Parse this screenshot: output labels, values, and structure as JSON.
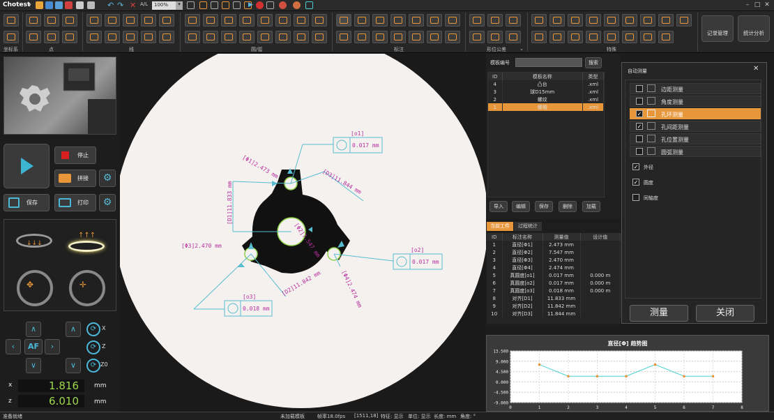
{
  "title_bar": {
    "app_name": "Chotest",
    "zoom": "100%",
    "min": "–",
    "max": "□",
    "close": "✕"
  },
  "ribbon": {
    "groups": [
      "坐标系",
      "点",
      "线",
      "圆/弧",
      "标注",
      "形位公差",
      "特殊"
    ],
    "record_button": "记录管理",
    "stats_button": "统计分析"
  },
  "left": {
    "stop_label": "停止",
    "stitch_label": "拼接",
    "save_label": "保存",
    "print_label": "打印",
    "af_label": "AF",
    "rot_x": "X",
    "rot_z": "Z",
    "rot_z0": "Z0",
    "x_label": "x",
    "x_value": "1.816",
    "x_unit": "mm",
    "z_label": "z",
    "z_value": "6.010",
    "z_unit": "mm"
  },
  "annotations": {
    "phi1": "[Φ1]2.473 mm",
    "phi2": "[Φ2]7.547 mm",
    "phi3": "[Φ3]2.470 mm",
    "phi4": "[Φ4]2.474 mm",
    "d1": "[D1]11.833 mm",
    "d2": "[D2]11.842 mm",
    "d3": "[D3]11.844 mm",
    "o1": "[o1]",
    "o1_val": "0.017 mm",
    "o2": "[o2]",
    "o2_val": "0.017 mm",
    "o3": "[o3]",
    "o3_val": "0.018 mm"
  },
  "template": {
    "label": "模板编号",
    "search": "搜索",
    "columns": [
      "ID",
      "模板名称",
      "类型"
    ],
    "rows": [
      {
        "id": "4",
        "name": "凸台",
        "type": ".xml"
      },
      {
        "id": "3",
        "name": "球D15mm",
        "type": ".xml"
      },
      {
        "id": "2",
        "name": "螺纹",
        "type": ".xml"
      },
      {
        "id": "1",
        "name": "螺帽",
        "type": ".xml"
      }
    ],
    "buttons": [
      "导入",
      "编辑",
      "保存",
      "删除",
      "加载"
    ]
  },
  "dialog": {
    "title": "自动测量",
    "options": [
      {
        "label": "边距测量",
        "checked": false
      },
      {
        "label": "角度测量",
        "checked": false
      },
      {
        "label": "孔环测量",
        "checked": true
      },
      {
        "label": "孔间距测量",
        "checked": true
      },
      {
        "label": "孔位置测量",
        "checked": false
      },
      {
        "label": "圆弧测量",
        "checked": false
      }
    ],
    "sub_options": [
      {
        "label": "外径",
        "checked": true
      },
      {
        "label": "圆度",
        "checked": true
      },
      {
        "label": "同轴度",
        "checked": false
      }
    ],
    "measure_btn": "测量",
    "close_btn": "关闭"
  },
  "results": {
    "tabs": [
      "当前工件",
      "过程统计"
    ],
    "columns": [
      "ID",
      "标注名称",
      "测量值",
      "设计值"
    ],
    "rows": [
      {
        "id": "1",
        "name": "直径[Φ1]",
        "val": "2.473 mm",
        "design": ""
      },
      {
        "id": "2",
        "name": "直径[Φ2]",
        "val": "7.547 mm",
        "design": ""
      },
      {
        "id": "3",
        "name": "直径[Φ3]",
        "val": "2.470 mm",
        "design": ""
      },
      {
        "id": "4",
        "name": "直径[Φ4]",
        "val": "2.474 mm",
        "design": ""
      },
      {
        "id": "5",
        "name": "真圆度[o1]",
        "val": "0.017 mm",
        "design": "0.000 m"
      },
      {
        "id": "6",
        "name": "真圆度[o2]",
        "val": "0.017 mm",
        "design": "0.000 m"
      },
      {
        "id": "7",
        "name": "真圆度[o3]",
        "val": "0.018 mm",
        "design": "0.000 m"
      },
      {
        "id": "8",
        "name": "对齐[D1]",
        "val": "11.833 mm",
        "design": ""
      },
      {
        "id": "9",
        "name": "对齐[D2]",
        "val": "11.842 mm",
        "design": ""
      },
      {
        "id": "10",
        "name": "对齐[D3]",
        "val": "11.844 mm",
        "design": ""
      }
    ]
  },
  "chart_data": {
    "type": "line",
    "title": "直径[Φ] 趋势图",
    "x": [
      1,
      2,
      3,
      4,
      5,
      6,
      7
    ],
    "series": [
      {
        "values": [
          7.547,
          2.473,
          2.47,
          2.474,
          7.547,
          2.473,
          2.47
        ]
      }
    ],
    "xlim": [
      0,
      8
    ],
    "ylim": [
      -9.0,
      13.5
    ],
    "yticks": [
      "13.500",
      "9.000",
      "4.500",
      "0.000",
      "-4.500",
      "-9.000"
    ],
    "xticks": [
      "0",
      "1",
      "2",
      "3",
      "4",
      "5",
      "6",
      "7",
      "8"
    ],
    "line_color": "#4ad0d0",
    "point_color": "#e8963a"
  },
  "status": {
    "ready": "准备就绪",
    "template": "未加载模板",
    "fps": "帧率18.0fps",
    "pos": "[1511,18]",
    "feature": "特征: 显示",
    "unit": "单位: 显示",
    "length": "长度: mm",
    "angle": "角度: °"
  }
}
